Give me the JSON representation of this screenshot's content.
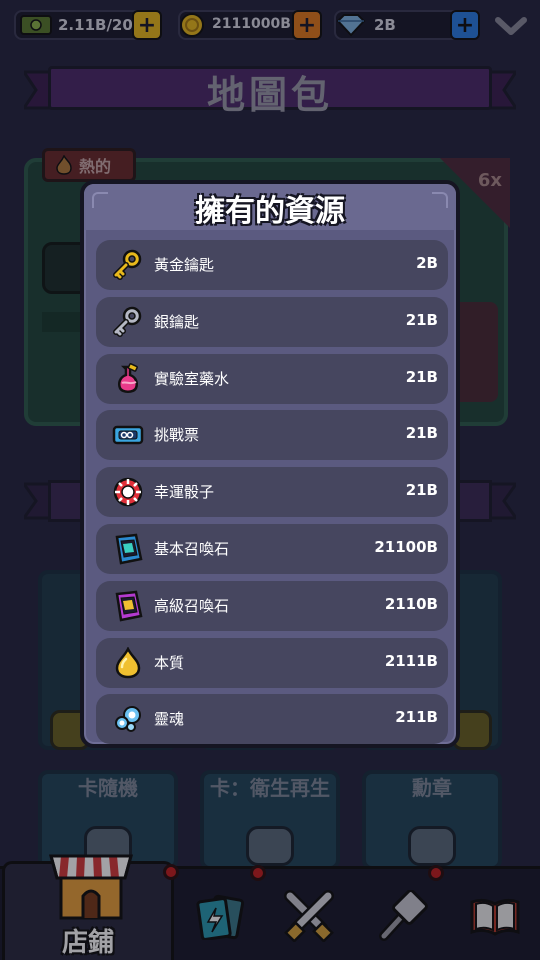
{
  "topbar": {
    "cash": "2.11B/20",
    "coins": "2111000B",
    "gems": "2B"
  },
  "background": {
    "page_title": "地圖包",
    "hot_tag": "熱的",
    "ribbon_text": "6x",
    "cards": [
      {
        "label": "卡隨機"
      },
      {
        "label": "卡：衛生再生"
      },
      {
        "label": "勳章"
      }
    ]
  },
  "modal": {
    "title": "擁有的資源",
    "resources": [
      {
        "name": "黃金鑰匙",
        "amount": "2B",
        "icon": "gold-key-icon"
      },
      {
        "name": "銀鑰匙",
        "amount": "21B",
        "icon": "silver-key-icon"
      },
      {
        "name": "實驗室藥水",
        "amount": "21B",
        "icon": "potion-icon"
      },
      {
        "name": "挑戰票",
        "amount": "21B",
        "icon": "ticket-icon"
      },
      {
        "name": "幸運骰子",
        "amount": "21B",
        "icon": "lucky-dice-icon"
      },
      {
        "name": "基本召喚石",
        "amount": "21100B",
        "icon": "basic-summon-stone-icon"
      },
      {
        "name": "高級召喚石",
        "amount": "2110B",
        "icon": "advanced-summon-stone-icon"
      },
      {
        "name": "本質",
        "amount": "2111B",
        "icon": "essence-drop-icon"
      },
      {
        "name": "靈魂",
        "amount": "211B",
        "icon": "soul-icon"
      }
    ]
  },
  "bottom_nav": {
    "shop_label": "店鋪",
    "tabs": [
      "shop",
      "cards",
      "battle",
      "upgrade",
      "book"
    ]
  },
  "colors": {
    "modal_bg": "#5b5a80",
    "row_bg": "#46465f",
    "plus_yellow": "#e8b91c",
    "plus_orange": "#e07a1c",
    "plus_blue": "#2a7de0",
    "badge_red": "#c41f1f"
  }
}
